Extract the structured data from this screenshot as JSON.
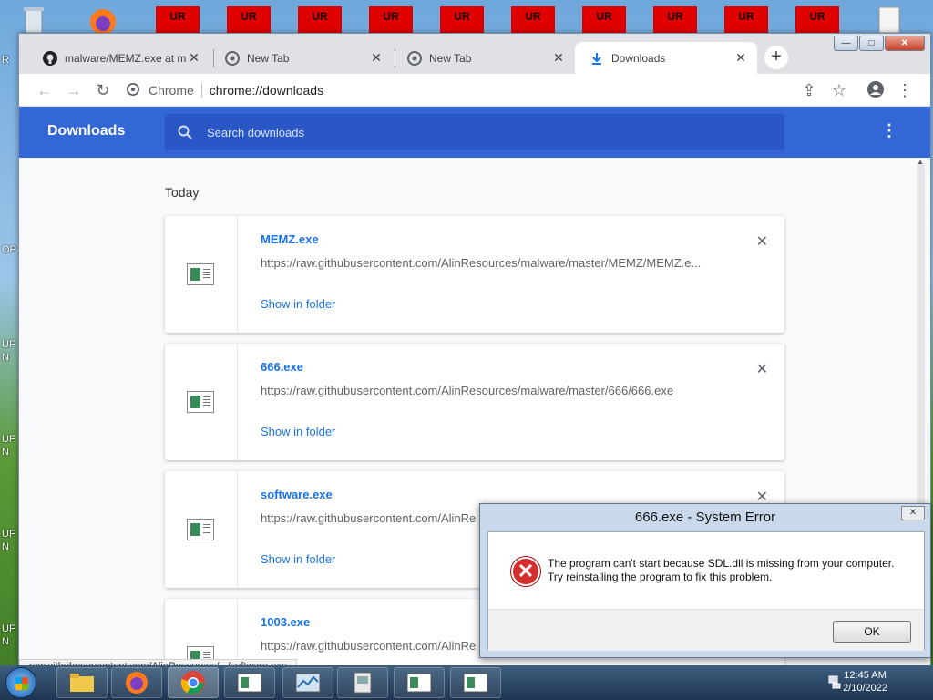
{
  "desktop": {
    "ur_labels": [
      "UR",
      "UR",
      "UR",
      "UR",
      "UR",
      "UR",
      "UR",
      "UR",
      "UR",
      "UR"
    ],
    "left_labels": [
      "R",
      "OP",
      "UF",
      "N",
      "UF",
      "N",
      "UF",
      "N",
      "UF",
      "N"
    ]
  },
  "window": {
    "tabs": [
      {
        "title": "malware/MEMZ.exe at m...",
        "icon": "github-icon",
        "active": false
      },
      {
        "title": "New Tab",
        "icon": "chrome-icon",
        "active": false
      },
      {
        "title": "New Tab",
        "icon": "chrome-icon",
        "active": false
      },
      {
        "title": "Downloads",
        "icon": "download-icon",
        "active": true
      }
    ],
    "new_tab_label": "+",
    "controls": {
      "minimize": "—",
      "maximize": "□",
      "close": "✕"
    }
  },
  "toolbar": {
    "site_label": "Chrome",
    "url": "chrome://downloads"
  },
  "downloads": {
    "title": "Downloads",
    "search_placeholder": "Search downloads",
    "date_header": "Today",
    "items": [
      {
        "name": "MEMZ.exe",
        "url": "https://raw.githubusercontent.com/AlinResources/malware/master/MEMZ/MEMZ.e...",
        "action": "Show in folder"
      },
      {
        "name": "666.exe",
        "url": "https://raw.githubusercontent.com/AlinResources/malware/master/666/666.exe",
        "action": "Show in folder"
      },
      {
        "name": "software.exe",
        "url": "https://raw.githubusercontent.com/AlinRe",
        "action": "Show in folder"
      },
      {
        "name": "1003.exe",
        "url": "https://raw.githubusercontent.com/AlinRe",
        "action": ""
      }
    ],
    "status_url": "raw.githubusercontent.com/AlinResources/.../software.exe"
  },
  "dialog": {
    "title": "666.exe - System Error",
    "message_line1": "The program can't start because SDL.dll is missing from your computer.",
    "message_line2": "Try reinstalling the program to fix this problem.",
    "ok_label": "OK",
    "close_label": "✕"
  },
  "taskbar": {
    "time": "12:45 AM",
    "date": "2/10/2022"
  }
}
